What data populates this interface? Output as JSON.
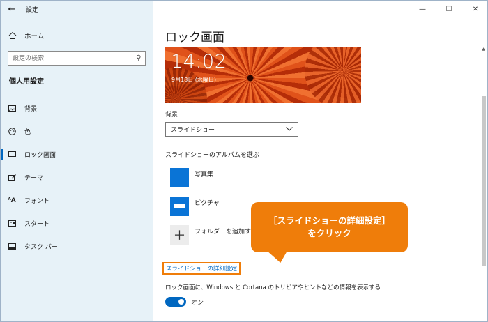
{
  "window": {
    "title": "設定",
    "back_glyph": "←",
    "minimize_glyph": "—",
    "maximize_glyph": "☐",
    "close_glyph": "✕"
  },
  "sidebar": {
    "home_label": "ホーム",
    "search_placeholder": "設定の検索",
    "section_title": "個人用設定",
    "items": [
      {
        "label": "背景",
        "icon": "picture-icon",
        "glyph": "▭"
      },
      {
        "label": "色",
        "icon": "palette-icon",
        "glyph": "◔"
      },
      {
        "label": "ロック画面",
        "icon": "lock-screen-icon",
        "glyph": "▯"
      },
      {
        "label": "テーマ",
        "icon": "brush-icon",
        "glyph": "✎"
      },
      {
        "label": "フォント",
        "icon": "font-icon",
        "glyph": "ᴬA"
      },
      {
        "label": "スタート",
        "icon": "start-icon",
        "glyph": "▤"
      },
      {
        "label": "タスク バー",
        "icon": "taskbar-icon",
        "glyph": "▬"
      }
    ],
    "active_index": 2
  },
  "main": {
    "page_title": "ロック画面",
    "preview": {
      "time": "14:02",
      "date": "9月18日 (水曜日)"
    },
    "background_label": "背景",
    "background_value": "スライドショー",
    "album_label": "スライドショーのアルバムを選ぶ",
    "albums": [
      {
        "name": "写真集"
      },
      {
        "name": "ピクチャ"
      }
    ],
    "add_folder_label": "フォルダーを追加する",
    "add_glyph": "＋",
    "slideshow_settings_link": "スライドショーの詳細設定",
    "tips_label": "ロック画面に、Windows と Cortana のトリビアやヒントなどの情報を表示する",
    "toggle_state": "オン"
  },
  "callout": {
    "line1": "［スライドショーの詳細設定］",
    "line2": "をクリック"
  },
  "colors": {
    "accent": "#0067c0",
    "callout": "#ef7d0a",
    "sidebar_bg": "#e7f2f8"
  }
}
